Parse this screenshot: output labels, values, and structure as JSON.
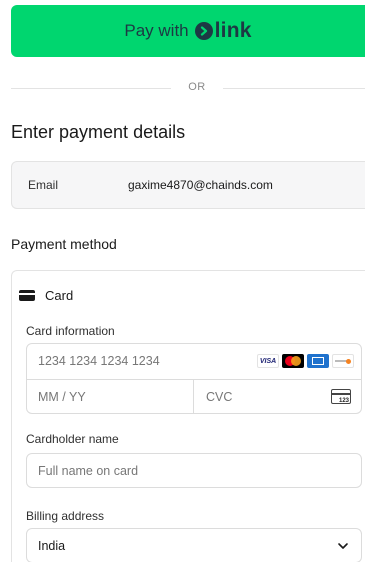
{
  "link_button": {
    "pay_with": "Pay with",
    "brand": "link"
  },
  "divider": {
    "or_text": "OR"
  },
  "section_title": "Enter payment details",
  "email": {
    "label": "Email",
    "value": "gaxime4870@chainds.com"
  },
  "payment_method": {
    "title": "Payment method",
    "tab_label": "Card",
    "tab_icon": "credit-card-icon"
  },
  "card_info": {
    "label": "Card information",
    "number_placeholder": "1234 1234 1234 1234",
    "expiry_placeholder": "MM / YY",
    "cvc_placeholder": "CVC",
    "cvc_icon_text": "123",
    "brands": [
      "VISA",
      "mastercard",
      "amex",
      "discover"
    ]
  },
  "cardholder": {
    "label": "Cardholder name",
    "placeholder": "Full name on card"
  },
  "billing": {
    "label": "Billing address",
    "country": "India"
  },
  "colors": {
    "link_green": "#00d66f",
    "link_dark": "#1d3944"
  }
}
